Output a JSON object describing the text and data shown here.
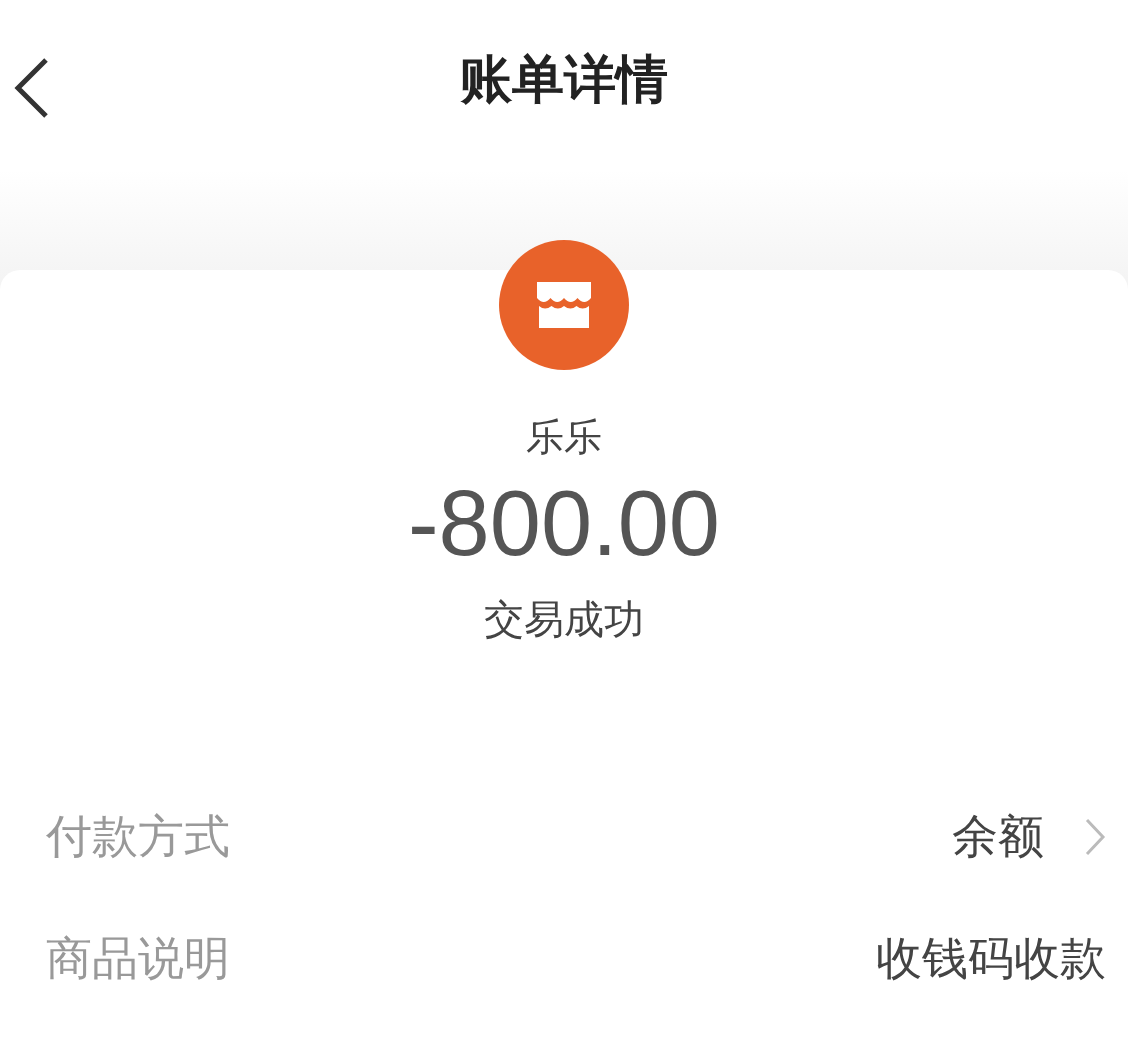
{
  "header": {
    "title": "账单详情"
  },
  "merchant": {
    "name": "乐乐",
    "amount": "-800.00",
    "status": "交易成功"
  },
  "details": [
    {
      "label": "付款方式",
      "value": "余额",
      "has_arrow": true
    },
    {
      "label": "商品说明",
      "value": "收钱码收款",
      "has_arrow": false
    }
  ]
}
